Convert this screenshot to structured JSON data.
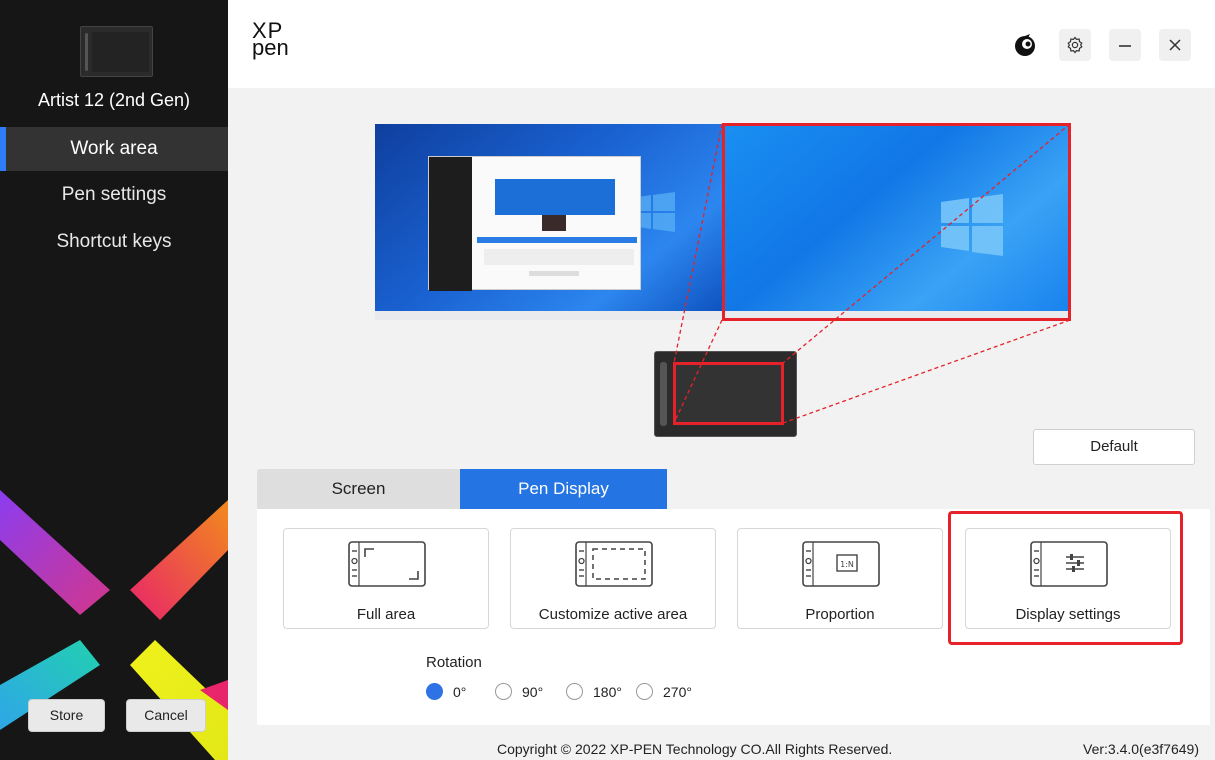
{
  "sidebar": {
    "device_name": "Artist 12 (2nd Gen)",
    "items": [
      {
        "label": "Work area",
        "active": true
      },
      {
        "label": "Pen settings"
      },
      {
        "label": "Shortcut keys"
      }
    ],
    "store_label": "Store",
    "cancel_label": "Cancel"
  },
  "header": {
    "logo_line1": "XP",
    "logo_line2": "pen",
    "icons": [
      "pen-mascot-icon",
      "gear-icon",
      "minimize-icon",
      "close-icon"
    ]
  },
  "preview": {
    "monitors": 2,
    "selected_monitor": 2,
    "highlight_color": "#e5222a"
  },
  "default_label": "Default",
  "tabs": [
    {
      "label": "Screen",
      "active": false
    },
    {
      "label": "Pen Display",
      "active": true
    }
  ],
  "options": [
    {
      "label": "Full area",
      "icon": "full-area-icon"
    },
    {
      "label": "Customize active area",
      "icon": "custom-area-icon"
    },
    {
      "label": "Proportion",
      "icon": "proportion-icon",
      "badge": "1:N"
    },
    {
      "label": "Display settings",
      "icon": "display-settings-icon",
      "highlighted": true
    }
  ],
  "rotation": {
    "label": "Rotation",
    "options": [
      "0°",
      "90°",
      "180°",
      "270°"
    ],
    "selected": "0°"
  },
  "footer": {
    "copyright": "Copyright © 2022  XP-PEN Technology CO.All Rights Reserved.",
    "version": "Ver:3.4.0(e3f7649)"
  },
  "colors": {
    "accent": "#2475e3",
    "sidebar_bg": "#161616",
    "highlight": "#e5222a"
  }
}
